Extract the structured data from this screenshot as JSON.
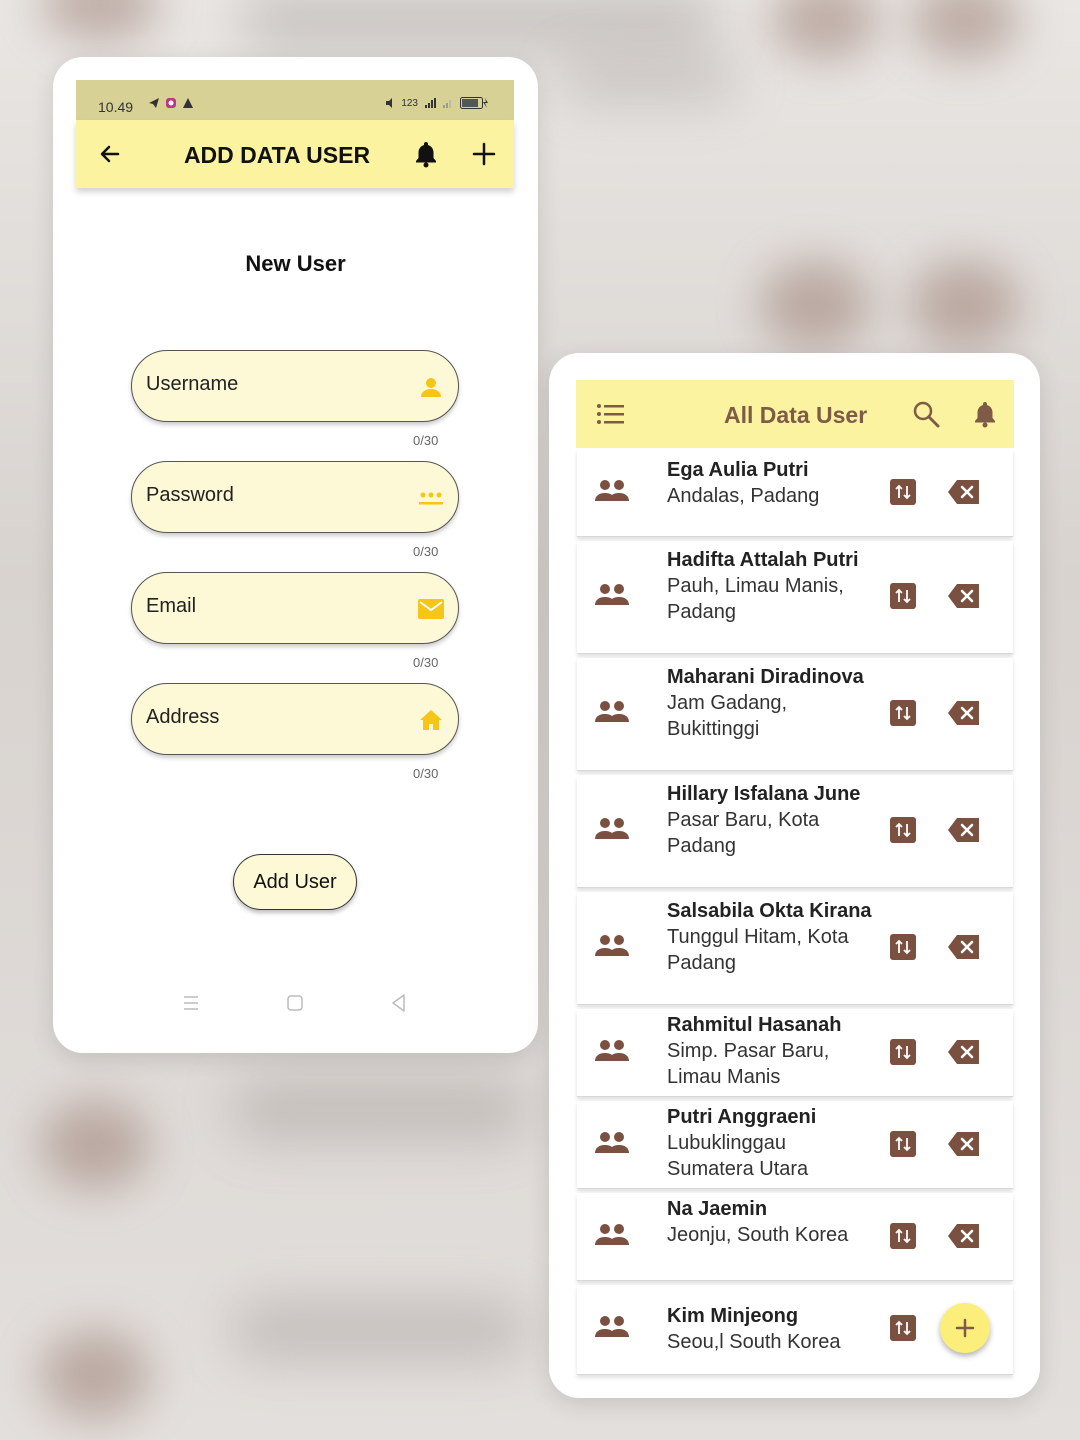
{
  "colors": {
    "appbar": "#fbf3a0",
    "field_bg": "#fdf8d6",
    "accent_yellow": "#f5c518",
    "brown": "#7a5040"
  },
  "add_screen": {
    "status_bar": {
      "time": "10.49",
      "right_text": "123"
    },
    "appbar": {
      "title": "ADD DATA USER",
      "back_icon": "arrow-left-icon",
      "bell_icon": "bell-icon",
      "add_icon": "plus-icon"
    },
    "form": {
      "title": "New User",
      "fields": [
        {
          "label": "Username",
          "icon": "person-icon",
          "counter": "0/30"
        },
        {
          "label": "Password",
          "icon": "dots-icon",
          "counter": "0/30"
        },
        {
          "label": "Email",
          "icon": "mail-icon",
          "counter": "0/30"
        },
        {
          "label": "Address",
          "icon": "home-icon",
          "counter": "0/30"
        }
      ],
      "submit_label": "Add User"
    }
  },
  "list_screen": {
    "appbar": {
      "title": "All Data User",
      "menu_icon": "list-icon",
      "search_icon": "search-icon",
      "bell_icon": "bell-icon"
    },
    "users": [
      {
        "name": "Ega Aulia Putri",
        "address": "Andalas, Padang"
      },
      {
        "name": "Hadifta Attalah Putri",
        "address": "Pauh, Limau Manis, Padang"
      },
      {
        "name": "Maharani Diradinova",
        "address": "Jam Gadang, Bukittinggi"
      },
      {
        "name": "Hillary Isfalana June",
        "address": "Pasar Baru, Kota Padang"
      },
      {
        "name": "Salsabila Okta Kirana",
        "address": "Tunggul Hitam, Kota Padang"
      },
      {
        "name": "Rahmitul Hasanah",
        "address": "Simp. Pasar Baru, Limau Manis"
      },
      {
        "name": "Putri Anggraeni",
        "address": "Lubuklinggau Sumatera Utara"
      },
      {
        "name": "Na Jaemin",
        "address": "Jeonju, South Korea"
      },
      {
        "name": "Kim Minjeong",
        "address": "Seou,l South Korea"
      }
    ],
    "fab_icon": "plus-icon"
  }
}
